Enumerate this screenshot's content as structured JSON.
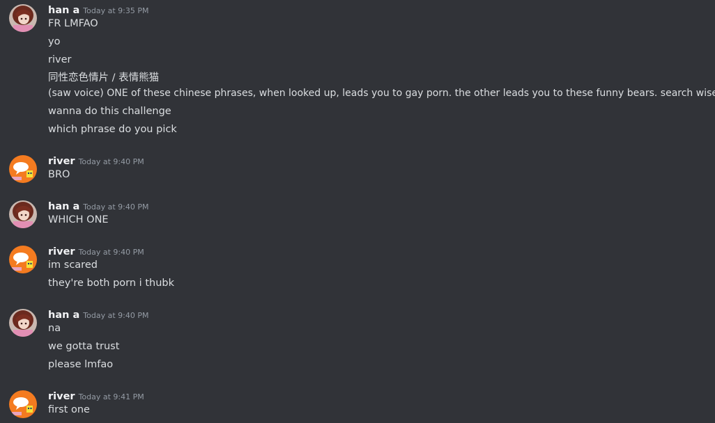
{
  "users": {
    "han": "han a",
    "river": "river"
  },
  "groups": [
    {
      "user": "han a",
      "time": "Today at 9:35 PM",
      "lines": [
        "FR LMFAO",
        "yo",
        "river",
        "同性恋色情片 / 表情熊猫",
        "(saw voice) ONE of these chinese phrases, when looked up, leads you to gay porn. the other leads you to these funny bears. search wisely",
        "wanna do this challenge",
        "which phrase do you pick"
      ]
    },
    {
      "user": "river",
      "time": "Today at 9:40 PM",
      "lines": [
        "BRO"
      ]
    },
    {
      "user": "han a",
      "time": "Today at 9:40 PM",
      "lines": [
        "WHICH ONE"
      ]
    },
    {
      "user": "river",
      "time": "Today at 9:40 PM",
      "lines": [
        "im scared",
        "they're both porn i thubk"
      ]
    },
    {
      "user": "han a",
      "time": "Today at 9:40 PM",
      "lines": [
        "na",
        "we gotta trust",
        "please lmfao"
      ]
    },
    {
      "user": "river",
      "time": "Today at 9:41 PM",
      "lines": [
        "first one"
      ]
    }
  ],
  "colors": {
    "background": "#313338",
    "username": "#f2f3f5",
    "timestamp": "#949ba4",
    "message_text": "#dbdee1",
    "river_avatar": "#f47b20"
  },
  "icons": {
    "han_avatar": "anime-character-avatar",
    "river_avatar": "spongebob-speech-bubble-avatar"
  }
}
